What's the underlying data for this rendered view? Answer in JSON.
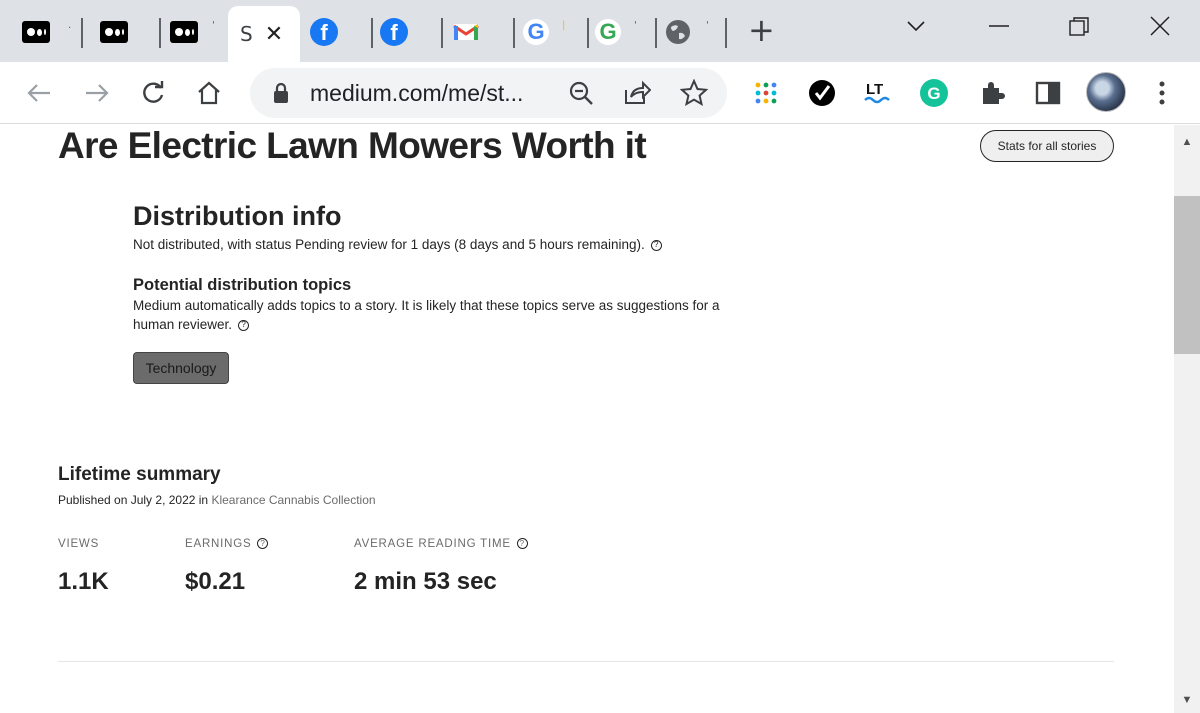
{
  "browser": {
    "tabs": [
      {
        "kind": "medium",
        "icon": "medium-icon"
      },
      {
        "kind": "medium",
        "icon": "medium-icon"
      },
      {
        "kind": "medium",
        "icon": "medium-icon"
      },
      {
        "kind": "active",
        "title": "S",
        "icon": "close-icon"
      },
      {
        "kind": "facebook",
        "icon": "facebook-icon"
      },
      {
        "kind": "facebook",
        "icon": "facebook-icon"
      },
      {
        "kind": "gmail",
        "icon": "gmail-icon"
      },
      {
        "kind": "google",
        "icon": "google-icon"
      },
      {
        "kind": "google",
        "icon": "google-icon"
      },
      {
        "kind": "web",
        "icon": "globe-icon"
      }
    ],
    "url": "medium.com/me/st...",
    "accent": "#1a73e8"
  },
  "story": {
    "title": "Are Electric Lawn Mowers Worth it",
    "stats_all_label": "Stats for all stories"
  },
  "distribution": {
    "heading": "Distribution info",
    "status_text": "Not distributed, with status Pending review for 1 days (8 days and 5 hours remaining).",
    "topics_heading": "Potential distribution topics",
    "topics_text": "Medium automatically adds topics to a story. It is likely that these topics serve as suggestions for a human reviewer.",
    "topics": [
      "Technology"
    ]
  },
  "lifetime": {
    "heading": "Lifetime summary",
    "published_prefix": "Published on July 2, 2022 in",
    "publication": "Klearance Cannabis Collection",
    "metrics": [
      {
        "label": "VIEWS",
        "value": "1.1K"
      },
      {
        "label": "EARNINGS",
        "value": "$0.21"
      },
      {
        "label": "AVERAGE READING TIME",
        "value": "2 min 53 sec"
      }
    ]
  }
}
